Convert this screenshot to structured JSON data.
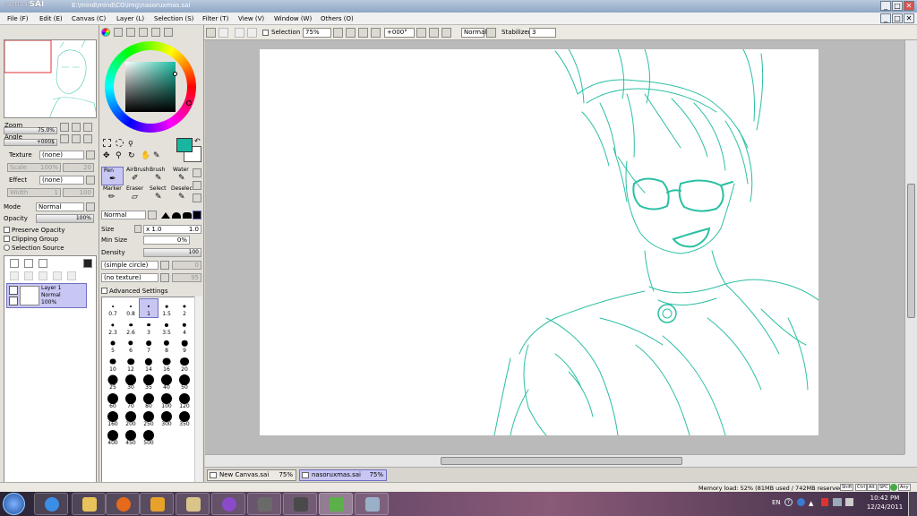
{
  "window": {
    "app_name": "SAI",
    "app_prefix": "PaintTool",
    "file_path": "E:\\mind\\mind\\CG\\img\\nasoruxmas.sai",
    "controls": {
      "minimize": "_",
      "maximize": "□",
      "close": "✕"
    }
  },
  "menu": [
    "File (F)",
    "Edit (E)",
    "Canvas (C)",
    "Layer (L)",
    "Selection (S)",
    "Filter (T)",
    "View (V)",
    "Window (W)",
    "Others (O)"
  ],
  "toolbar": {
    "selection_label": "Selection",
    "zoom_value": "75%",
    "angle_value": "+000°",
    "blend_value": "Normal",
    "stabilizer_label": "Stabilizer",
    "stabilizer_value": "3"
  },
  "navigator": {
    "zoom_label": "Zoom",
    "zoom_value": "75.0%",
    "angle_label": "Angle",
    "angle_value": "+000$"
  },
  "texture": {
    "label": "Texture",
    "value": "(none)",
    "scale_label": "Scale",
    "scale_value": "100%",
    "scale_num": "20"
  },
  "effect": {
    "label": "Effect",
    "value": "(none)",
    "width_label": "Width",
    "width_value": "1",
    "width_num": "100"
  },
  "layer_props": {
    "mode_label": "Mode",
    "mode_value": "Normal",
    "opacity_label": "Opacity",
    "opacity_value": "100%",
    "preserve_opacity": "Preserve Opacity",
    "clipping_group": "Clipping Group",
    "selection_source": "Selection Source"
  },
  "layers": [
    {
      "name": "Layer 1",
      "mode": "Normal",
      "opacity": "100%"
    }
  ],
  "colors": {
    "primary": "#1ab5a0",
    "secondary": "#ffffff",
    "sketch": "#2bbfa3"
  },
  "tools": [
    {
      "label": "Pen"
    },
    {
      "label": "AirBrush"
    },
    {
      "label": "Brush"
    },
    {
      "label": "Water"
    },
    {
      "label": "Marker"
    },
    {
      "label": "Eraser"
    },
    {
      "label": "Select"
    },
    {
      "label": "Deselect"
    }
  ],
  "brush": {
    "blend_value": "Normal",
    "size_label": "Size",
    "size_mult": "x 1.0",
    "size_value": "1.0",
    "minsize_label": "Min Size",
    "minsize_value": "0%",
    "density_label": "Density",
    "density_value": "100",
    "shape_value": "(simple circle)",
    "shape_num": "0",
    "texture_value": "(no texture)",
    "texture_num": "95",
    "advanced_label": "Advanced Settings"
  },
  "brush_sizes": [
    "0.7",
    "0.8",
    "1",
    "1.5",
    "2",
    "2.3",
    "2.6",
    "3",
    "3.5",
    "4",
    "5",
    "6",
    "7",
    "8",
    "9",
    "10",
    "12",
    "14",
    "16",
    "20",
    "25",
    "30",
    "35",
    "40",
    "50",
    "60",
    "70",
    "80",
    "100",
    "120",
    "160",
    "200",
    "250",
    "300",
    "350",
    "400",
    "450",
    "500"
  ],
  "doc_tabs": [
    {
      "name": "New Canvas.sai",
      "zoom": "75%"
    },
    {
      "name": "nasoruxmas.sai",
      "zoom": "75%"
    }
  ],
  "status": {
    "memory": "Memory load: 52% (81MB used / 742MB reserved)",
    "keys": [
      "Shift",
      "Ctrl",
      "Alt",
      "SPC",
      "Any"
    ]
  },
  "taskbar": {
    "lang": "EN",
    "time": "10:42 PM",
    "date": "12/24/2011"
  }
}
